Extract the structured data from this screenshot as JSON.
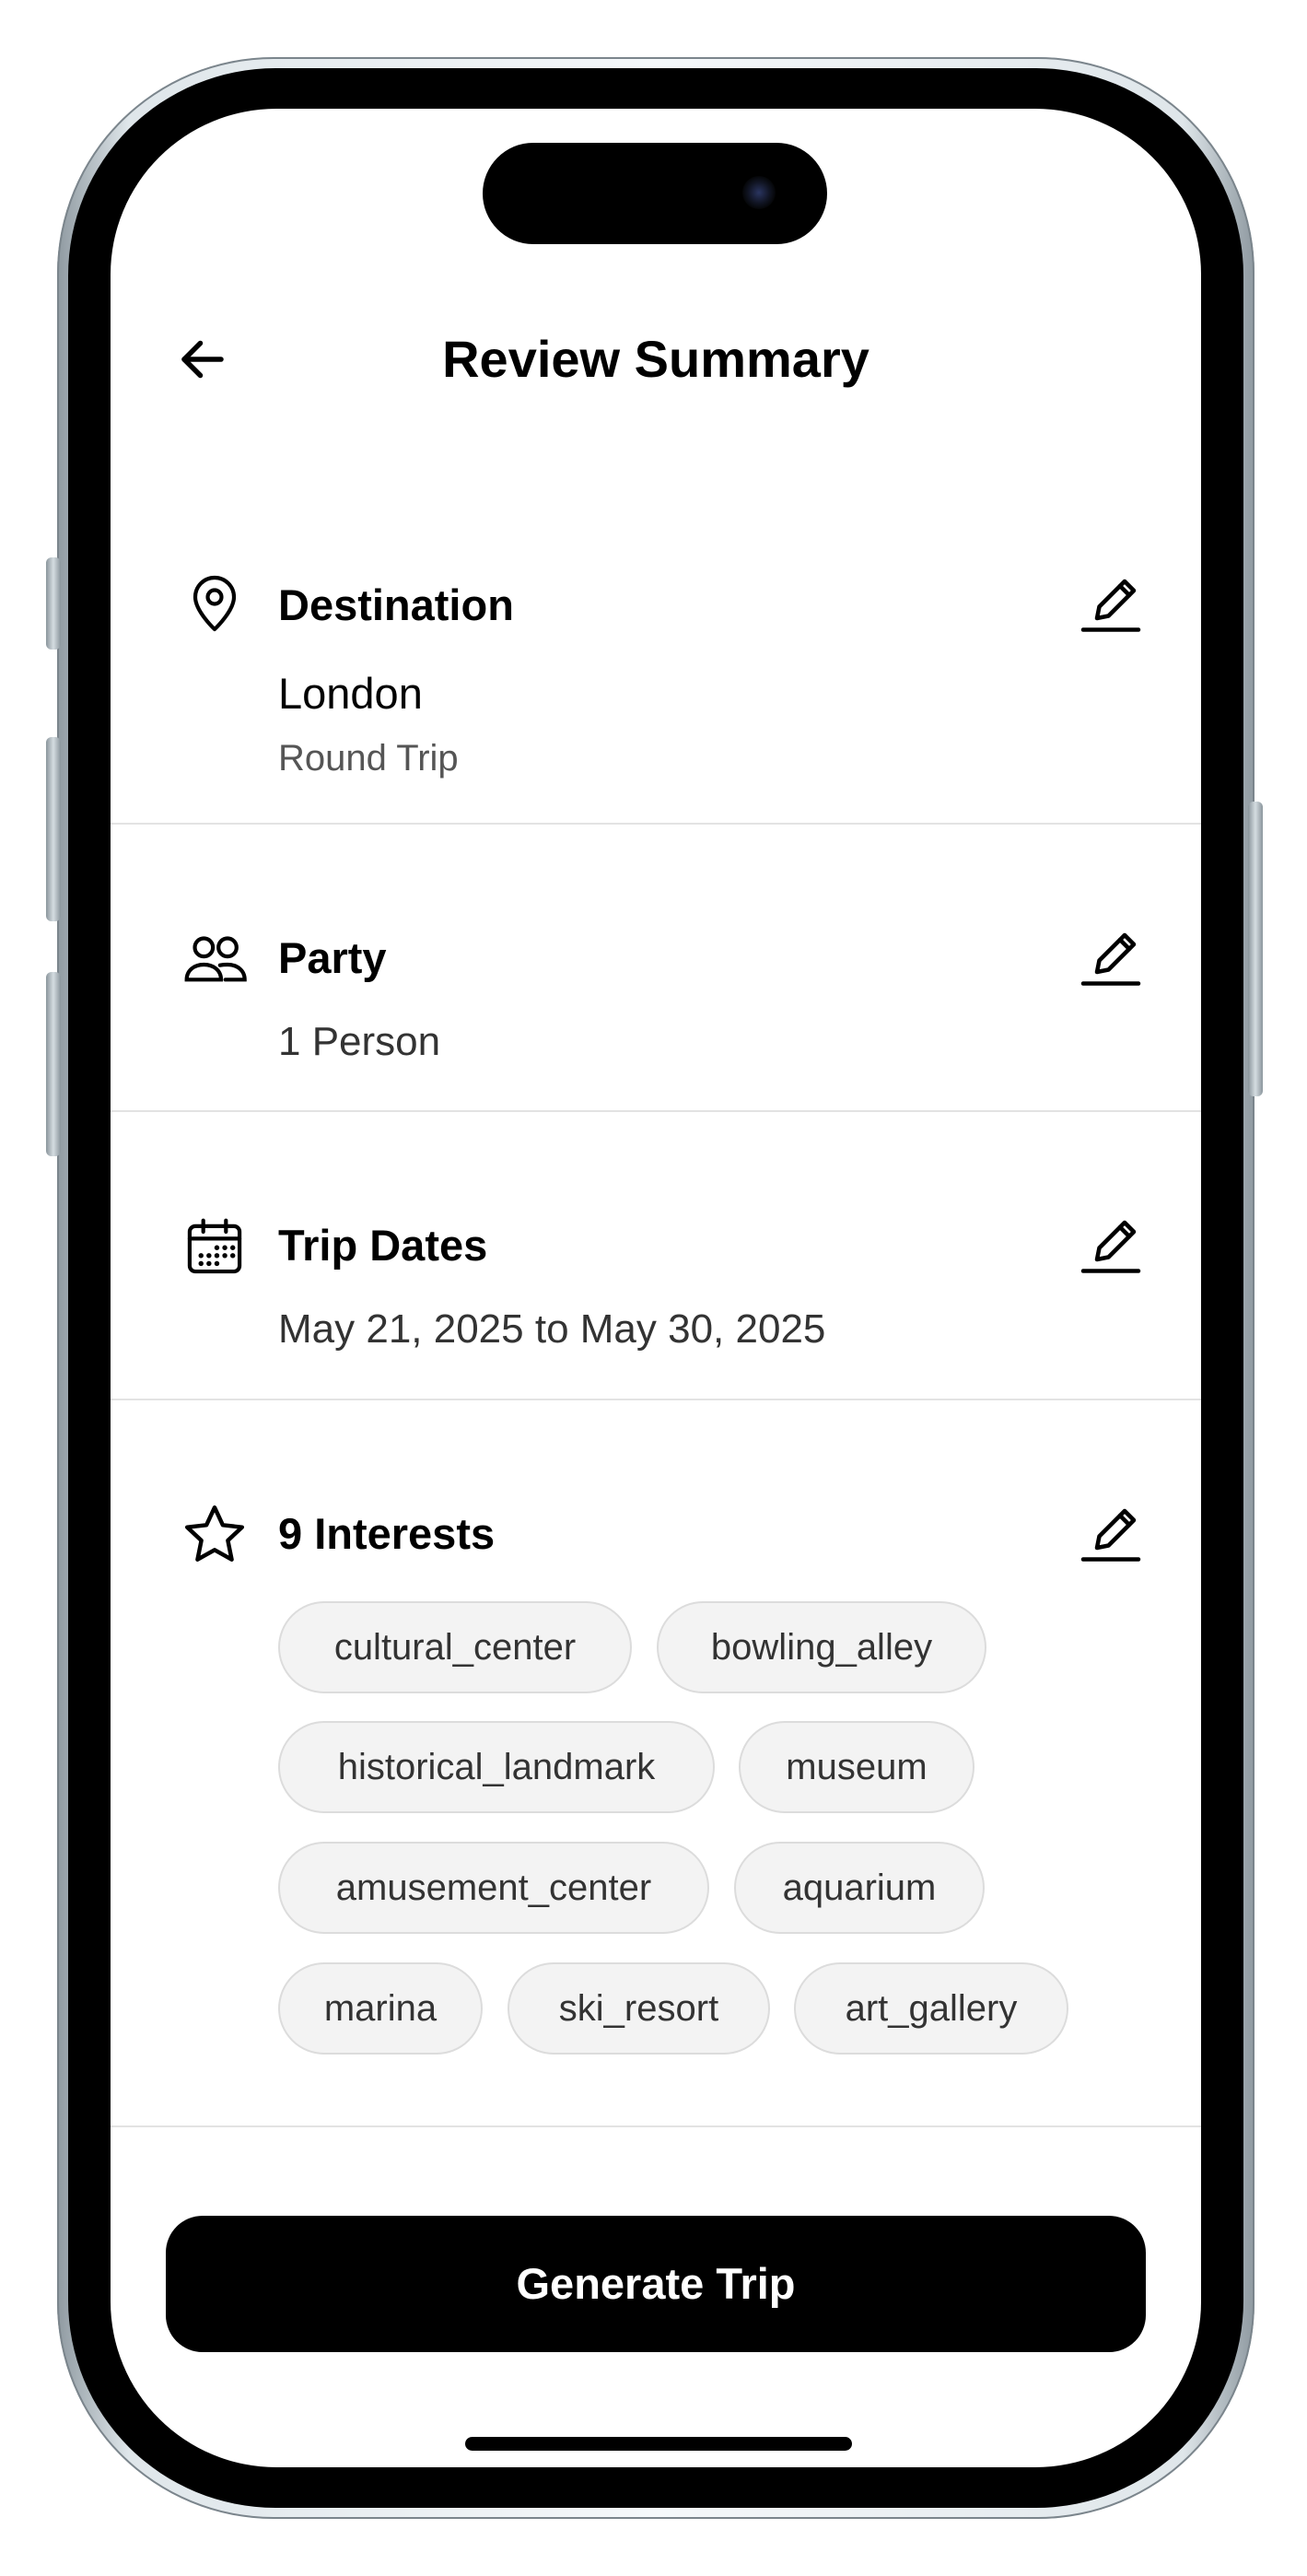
{
  "header": {
    "title": "Review Summary"
  },
  "destination": {
    "title": "Destination",
    "value": "London",
    "trip_type": "Round Trip"
  },
  "party": {
    "title": "Party",
    "value": "1 Person"
  },
  "dates": {
    "title": "Trip Dates",
    "value": "May 21, 2025 to May 30, 2025"
  },
  "interests": {
    "title": "9 Interests",
    "items": [
      "cultural_center",
      "bowling_alley",
      "historical_landmark",
      "museum",
      "amusement_center",
      "aquarium",
      "marina",
      "ski_resort",
      "art_gallery"
    ]
  },
  "cta": {
    "label": "Generate Trip"
  },
  "icons": {
    "back": "arrow-left-icon",
    "destination": "map-pin-icon",
    "party": "users-icon",
    "dates": "calendar-icon",
    "interests": "star-icon",
    "edit": "pencil-icon"
  }
}
